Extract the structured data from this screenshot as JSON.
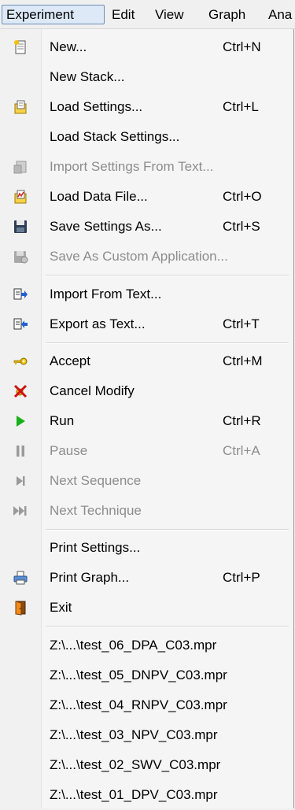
{
  "menubar": {
    "experiment": "Experiment",
    "edit": "Edit",
    "view": "View",
    "graph": "Graph",
    "analysis": "Ana"
  },
  "menu": {
    "new": {
      "label": "New...",
      "shortcut": "Ctrl+N",
      "icon": "new-document-icon"
    },
    "new_stack": {
      "label": "New Stack..."
    },
    "load_settings": {
      "label": "Load Settings...",
      "shortcut": "Ctrl+L",
      "icon": "load-settings-icon"
    },
    "load_stack_settings": {
      "label": "Load Stack Settings..."
    },
    "import_settings_text": {
      "label": "Import Settings From Text...",
      "icon": "import-settings-icon",
      "disabled": true
    },
    "load_data_file": {
      "label": "Load Data File...",
      "shortcut": "Ctrl+O",
      "icon": "load-data-icon"
    },
    "save_settings_as": {
      "label": "Save Settings As...",
      "shortcut": "Ctrl+S",
      "icon": "save-icon"
    },
    "save_custom_app": {
      "label": "Save As Custom Application...",
      "icon": "save-custom-icon",
      "disabled": true
    },
    "import_from_text": {
      "label": "Import From Text...",
      "icon": "import-text-icon"
    },
    "export_as_text": {
      "label": "Export as Text...",
      "shortcut": "Ctrl+T",
      "icon": "export-text-icon"
    },
    "accept": {
      "label": "Accept",
      "shortcut": "Ctrl+M",
      "icon": "key-icon"
    },
    "cancel_modify": {
      "label": "Cancel Modify",
      "icon": "cancel-icon"
    },
    "run": {
      "label": "Run",
      "shortcut": "Ctrl+R",
      "icon": "play-icon"
    },
    "pause": {
      "label": "Pause",
      "shortcut": "Ctrl+A",
      "icon": "pause-icon",
      "disabled": true
    },
    "next_sequence": {
      "label": "Next Sequence",
      "icon": "next-sequence-icon",
      "disabled": true
    },
    "next_technique": {
      "label": "Next Technique",
      "icon": "next-technique-icon",
      "disabled": true
    },
    "print_settings": {
      "label": "Print Settings..."
    },
    "print_graph": {
      "label": "Print Graph...",
      "shortcut": "Ctrl+P",
      "icon": "printer-icon"
    },
    "exit": {
      "label": "Exit",
      "icon": "exit-door-icon"
    }
  },
  "recent_files": [
    "Z:\\...\\test_06_DPA_C03.mpr",
    "Z:\\...\\test_05_DNPV_C03.mpr",
    "Z:\\...\\test_04_RNPV_C03.mpr",
    "Z:\\...\\test_03_NPV_C03.mpr",
    "Z:\\...\\test_02_SWV_C03.mpr",
    "Z:\\...\\test_01_DPV_C03.mpr"
  ],
  "colors": {
    "menu_bg": "#f5f5f5",
    "disabled_text": "#8d8d8d",
    "active_border": "#6d8fb7",
    "run_green": "#18b018"
  }
}
